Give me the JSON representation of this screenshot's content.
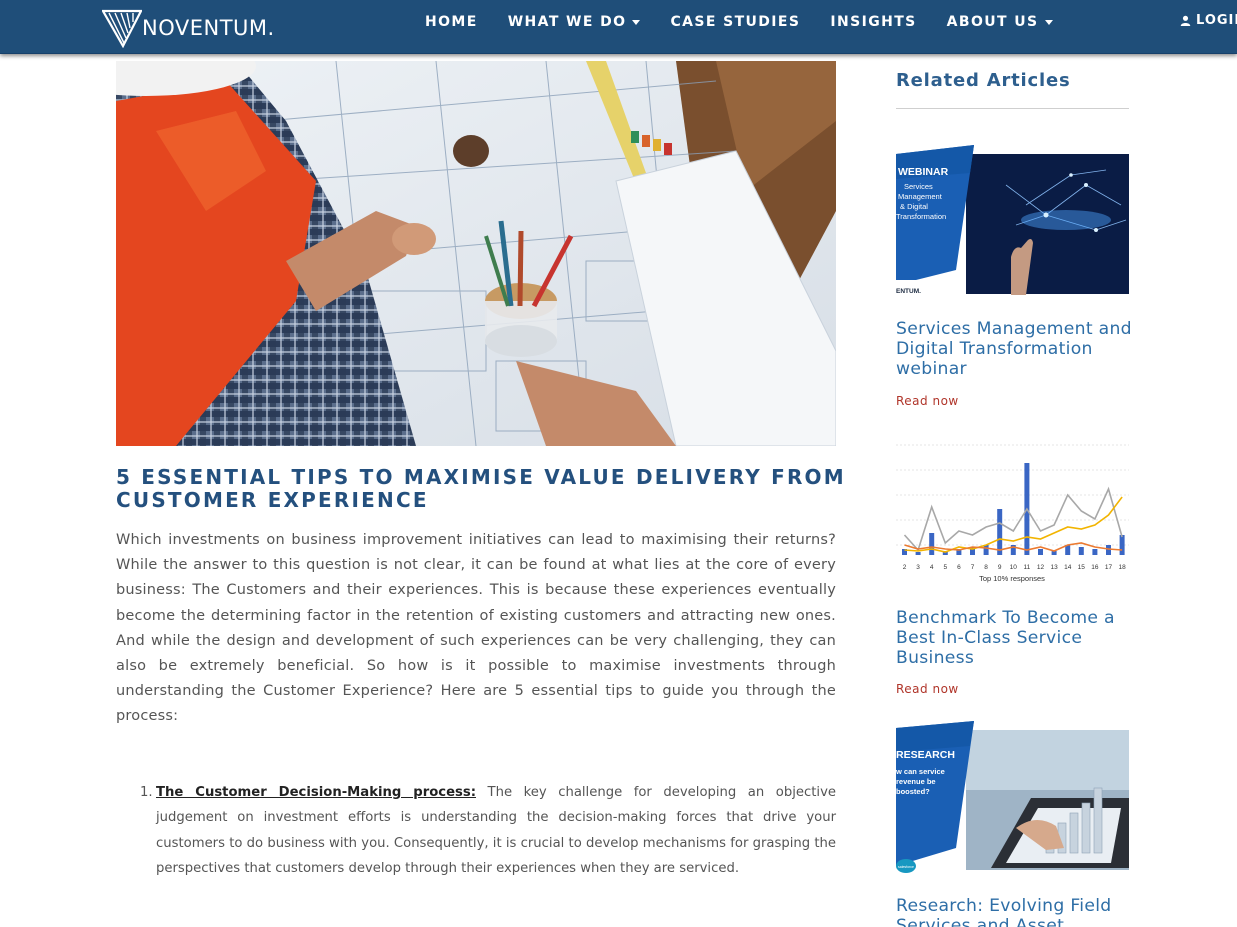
{
  "brand": {
    "name": "NOVENTUM."
  },
  "nav": {
    "items": [
      {
        "label": "HOME"
      },
      {
        "label": "WHAT WE DO"
      },
      {
        "label": "CASE STUDIES"
      },
      {
        "label": "INSIGHTS"
      },
      {
        "label": "ABOUT US"
      }
    ],
    "login": "LOGIN"
  },
  "article": {
    "title": "5 ESSENTIAL TIPS TO MAXIMISE VALUE DELIVERY FROM CUSTOMER EXPERIENCE",
    "intro": "Which investments on business improvement initiatives can lead to maximising their returns? While the answer to this question is not clear, it can be found at what lies at the core of every business: The Customers and their experiences. This is because these experiences eventually become the determining factor in the retention of existing customers and attracting new ones. And while the design and development of such experiences can be very challenging, they can also be extremely beneficial. So how is it possible to maximise investments through understanding the Customer Experience? Here are 5 essential tips to guide you through the process:",
    "tips": [
      {
        "number": "1.",
        "heading": "The Customer Decision-Making process:",
        "text": " The key challenge for developing an objective judgement on investment efforts is understanding the decision-making forces that drive your customers to do business with you. Consequently, it is crucial to develop mechanisms for grasping the perspectives that customers develop through their experiences when they are serviced."
      }
    ]
  },
  "sidebar": {
    "heading": "Related Articles",
    "cards": [
      {
        "title": "Services Management and Digital Transformation webinar",
        "link": "Read now",
        "image": {
          "tag": "WEBINAR",
          "lines": [
            "Services",
            "Management",
            "& Digital",
            "Transformation"
          ],
          "footer": "ENTUM."
        }
      },
      {
        "title": "Benchmark To Become a Best In-Class Service Business",
        "link": "Read now",
        "image": {
          "x_ticks": [
            "2",
            "3",
            "4",
            "5",
            "6",
            "7",
            "8",
            "9",
            "10",
            "11",
            "12",
            "13",
            "14",
            "15",
            "16",
            "17",
            "18"
          ],
          "caption": "Top 10% responses"
        }
      },
      {
        "title": "Research: Evolving Field Services and Asset",
        "link": "",
        "image": {
          "tag": "RESEARCH",
          "lines": [
            "w can service",
            "revenue be",
            "boosted?"
          ],
          "footer": "salesforce"
        }
      }
    ]
  },
  "colors": {
    "navbar": "#1f4e79",
    "title": "#24507e",
    "sidebar_heading": "#2e5f8e",
    "card_title": "#2e6ea6",
    "read_link": "#b0352a"
  }
}
